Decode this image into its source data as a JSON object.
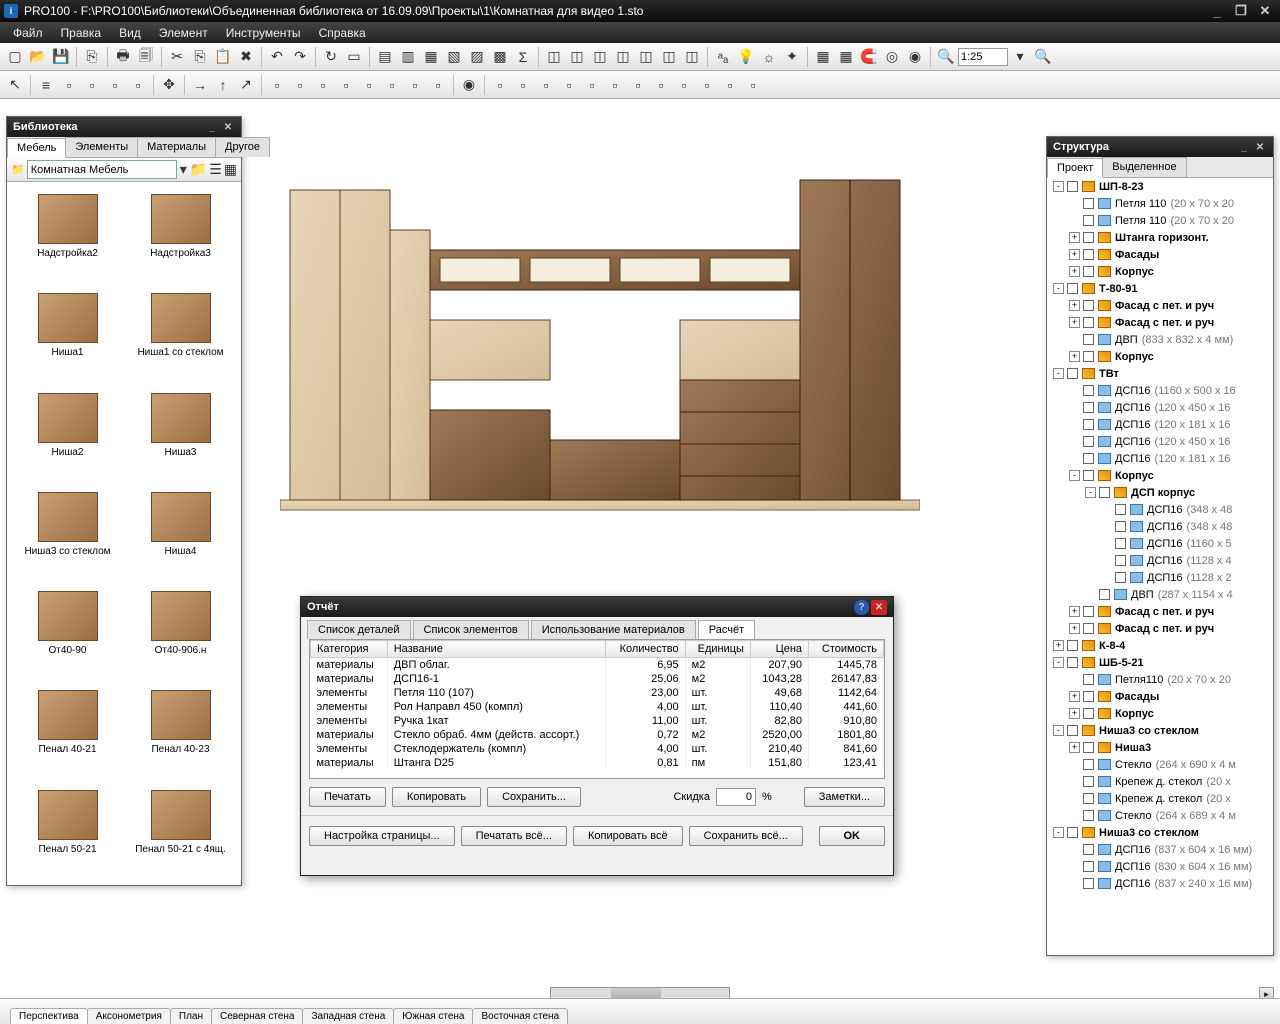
{
  "titlebar": {
    "app": "PRO100",
    "path": "F:\\PRO100\\Библиотеки\\Объединенная библиотека от 16.09.09\\Проекты\\1\\Комнатная для видео 1.sto"
  },
  "menu": [
    "Файл",
    "Правка",
    "Вид",
    "Элемент",
    "Инструменты",
    "Справка"
  ],
  "zoom": "1:25",
  "library": {
    "title": "Библиотека",
    "tabs": [
      "Мебель",
      "Элементы",
      "Материалы",
      "Другое"
    ],
    "active_tab": 0,
    "folder": "Комнатная Мебель",
    "items": [
      "Надстройка2",
      "Надстройка3",
      "Ниша1",
      "Ниша1 со стеклом",
      "Ниша2",
      "Ниша3",
      "Ниша3 со стеклом",
      "Ниша4",
      "От40-90",
      "От40-906.н",
      "Пенал 40-21",
      "Пенал 40-23",
      "Пенал 50-21",
      "Пенал 50-21 с 4ящ."
    ]
  },
  "structure": {
    "title": "Структура",
    "tabs": [
      "Проект",
      "Выделенное"
    ],
    "active_tab": 0,
    "tree": [
      {
        "d": 0,
        "exp": "-",
        "icon": "grp",
        "label": "ШП-8-23",
        "bold": true
      },
      {
        "d": 1,
        "exp": " ",
        "icon": "leaf",
        "label": "Петля 110",
        "dims": "(20 x 70 x 20"
      },
      {
        "d": 1,
        "exp": " ",
        "icon": "leaf",
        "label": "Петля 110",
        "dims": "(20 x 70 x 20"
      },
      {
        "d": 1,
        "exp": "+",
        "icon": "grp",
        "label": "Штанга горизонт.",
        "bold": true
      },
      {
        "d": 1,
        "exp": "+",
        "icon": "grp",
        "label": "Фасады",
        "bold": true
      },
      {
        "d": 1,
        "exp": "+",
        "icon": "grp",
        "label": "Корпус",
        "bold": true
      },
      {
        "d": 0,
        "exp": "-",
        "icon": "grp",
        "label": "Т-80-91",
        "bold": true
      },
      {
        "d": 1,
        "exp": "+",
        "icon": "grp",
        "label": "Фасад с пет. и руч",
        "bold": true
      },
      {
        "d": 1,
        "exp": "+",
        "icon": "grp",
        "label": "Фасад с пет. и руч",
        "bold": true
      },
      {
        "d": 1,
        "exp": " ",
        "icon": "leaf",
        "label": "ДВП",
        "dims": "(833 x 832 x 4 мм)"
      },
      {
        "d": 1,
        "exp": "+",
        "icon": "grp",
        "label": "Корпус",
        "bold": true
      },
      {
        "d": 0,
        "exp": "-",
        "icon": "grp",
        "label": "ТВт",
        "bold": true
      },
      {
        "d": 1,
        "exp": " ",
        "icon": "leaf",
        "label": "ДСП16",
        "dims": "(1160 x 500 x 16"
      },
      {
        "d": 1,
        "exp": " ",
        "icon": "leaf",
        "label": "ДСП16",
        "dims": "(120 x 450 x 16"
      },
      {
        "d": 1,
        "exp": " ",
        "icon": "leaf",
        "label": "ДСП16",
        "dims": "(120 x 181 x 16"
      },
      {
        "d": 1,
        "exp": " ",
        "icon": "leaf",
        "label": "ДСП16",
        "dims": "(120 x 450 x 16"
      },
      {
        "d": 1,
        "exp": " ",
        "icon": "leaf",
        "label": "ДСП16",
        "dims": "(120 x 181 x 16"
      },
      {
        "d": 1,
        "exp": "-",
        "icon": "grp",
        "label": "Корпус",
        "bold": true
      },
      {
        "d": 2,
        "exp": "-",
        "icon": "grp",
        "label": "ДСП корпус",
        "bold": true
      },
      {
        "d": 3,
        "exp": " ",
        "icon": "leaf",
        "label": "ДСП16",
        "dims": "(348 x 48"
      },
      {
        "d": 3,
        "exp": " ",
        "icon": "leaf",
        "label": "ДСП16",
        "dims": "(348 x 48"
      },
      {
        "d": 3,
        "exp": " ",
        "icon": "leaf",
        "label": "ДСП16",
        "dims": "(1160 x 5"
      },
      {
        "d": 3,
        "exp": " ",
        "icon": "leaf",
        "label": "ДСП16",
        "dims": "(1128 x 4"
      },
      {
        "d": 3,
        "exp": " ",
        "icon": "leaf",
        "label": "ДСП16",
        "dims": "(1128 x 2"
      },
      {
        "d": 2,
        "exp": " ",
        "icon": "leaf",
        "label": "ДВП",
        "dims": "(287 x 1154 x 4"
      },
      {
        "d": 1,
        "exp": "+",
        "icon": "grp",
        "label": "Фасад с пет. и руч",
        "bold": true
      },
      {
        "d": 1,
        "exp": "+",
        "icon": "grp",
        "label": "Фасад с пет. и руч",
        "bold": true
      },
      {
        "d": 0,
        "exp": "+",
        "icon": "grp",
        "label": "К-8-4",
        "bold": true
      },
      {
        "d": 0,
        "exp": "-",
        "icon": "grp",
        "label": "ШБ-5-21",
        "bold": true
      },
      {
        "d": 1,
        "exp": " ",
        "icon": "leaf",
        "label": "Петля110",
        "dims": "(20 x 70 x 20"
      },
      {
        "d": 1,
        "exp": "+",
        "icon": "grp",
        "label": "Фасады",
        "bold": true
      },
      {
        "d": 1,
        "exp": "+",
        "icon": "grp",
        "label": "Корпус",
        "bold": true
      },
      {
        "d": 0,
        "exp": "-",
        "icon": "grp",
        "label": "Ниша3 со стеклом",
        "bold": true
      },
      {
        "d": 1,
        "exp": "+",
        "icon": "grp",
        "label": "Ниша3",
        "bold": true
      },
      {
        "d": 1,
        "exp": " ",
        "icon": "leaf",
        "label": "Стекло",
        "dims": "(264 x 690 x 4 м"
      },
      {
        "d": 1,
        "exp": " ",
        "icon": "leaf",
        "label": "Крепеж д. стекол",
        "dims": "(20 x"
      },
      {
        "d": 1,
        "exp": " ",
        "icon": "leaf",
        "label": "Крепеж д. стекол",
        "dims": "(20 x"
      },
      {
        "d": 1,
        "exp": " ",
        "icon": "leaf",
        "label": "Стекло",
        "dims": "(264 x 689 x 4 м"
      },
      {
        "d": 0,
        "exp": "-",
        "icon": "grp",
        "label": "Ниша3 со стеклом",
        "bold": true
      },
      {
        "d": 1,
        "exp": " ",
        "icon": "leaf",
        "label": "ДСП16",
        "dims": "(837 x 604 x 16 мм)"
      },
      {
        "d": 1,
        "exp": " ",
        "icon": "leaf",
        "label": "ДСП16",
        "dims": "(830 x 604 x 16 мм)"
      },
      {
        "d": 1,
        "exp": " ",
        "icon": "leaf",
        "label": "ДСП16",
        "dims": "(837 x 240 x 16 мм)"
      }
    ]
  },
  "report": {
    "title": "Отчёт",
    "tabs": [
      "Список деталей",
      "Список элементов",
      "Использование материалов",
      "Расчёт"
    ],
    "active_tab": 3,
    "headers": [
      "Категория",
      "Название",
      "Количество",
      "Единицы",
      "Цена",
      "Стоимость"
    ],
    "rows": [
      [
        "материалы",
        "ДВП облаг.",
        "6,95",
        "м2",
        "207,90",
        "1445,78"
      ],
      [
        "материалы",
        "ДСП16-1",
        "25,06",
        "м2",
        "1043,28",
        "26147,83"
      ],
      [
        "элементы",
        "Петля 110 (107)",
        "23,00",
        "шт.",
        "49,68",
        "1142,64"
      ],
      [
        "элементы",
        "Рол Направл 450 (компл)",
        "4,00",
        "шт.",
        "110,40",
        "441,60"
      ],
      [
        "элементы",
        "Ручка 1кат",
        "11,00",
        "шт.",
        "82,80",
        "910,80"
      ],
      [
        "материалы",
        "Стекло обраб. 4мм (действ. ассорт.)",
        "0,72",
        "м2",
        "2520,00",
        "1801,80"
      ],
      [
        "элементы",
        "Стеклодержатель (компл)",
        "4,00",
        "шт.",
        "210,40",
        "841,60"
      ],
      [
        "материалы",
        "Штанга D25",
        "0,81",
        "пм",
        "151,80",
        "123,41"
      ]
    ],
    "print": "Печатать",
    "copy": "Копировать",
    "save": "Сохранить...",
    "discount_label": "Скидка",
    "discount_value": "0",
    "notes": "Заметки...",
    "page_setup": "Настройка страницы...",
    "print_all": "Печатать всё...",
    "copy_all": "Копировать всё",
    "save_all": "Сохранить всё...",
    "ok": "OK"
  },
  "views": [
    "Перспектива",
    "Аксонометрия",
    "План",
    "Северная стена",
    "Западная стена",
    "Южная стена",
    "Восточная стена"
  ],
  "active_view": 0
}
